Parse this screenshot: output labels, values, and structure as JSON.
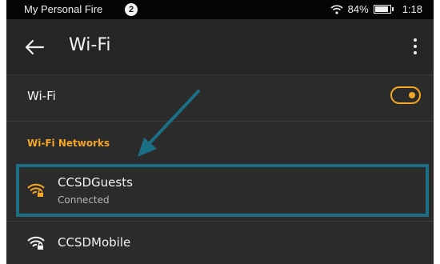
{
  "status_bar": {
    "device_name": "My Personal Fire",
    "notification_count": "2",
    "battery": "84%",
    "time": "1:18"
  },
  "app_bar": {
    "title": "Wi-Fi",
    "back_icon": "arrow-left-icon",
    "menu_icon": "more-vertical-icon"
  },
  "wifi_toggle": {
    "label": "Wi-Fi",
    "enabled": true
  },
  "networks_section": {
    "header": "Wi-Fi Networks",
    "networks": [
      {
        "ssid": "CCSDGuests",
        "status": "Connected",
        "secured": true,
        "icon": "wifi-lock-icon",
        "icon_color": "#f5a623"
      },
      {
        "ssid": "CCSDMobile",
        "status": "",
        "secured": true,
        "icon": "wifi-lock-icon",
        "icon_color": "#f2f2f2"
      }
    ]
  },
  "colors": {
    "accent": "#f5a623",
    "highlight": "#1b6f85",
    "background": "#2b2b2b"
  }
}
